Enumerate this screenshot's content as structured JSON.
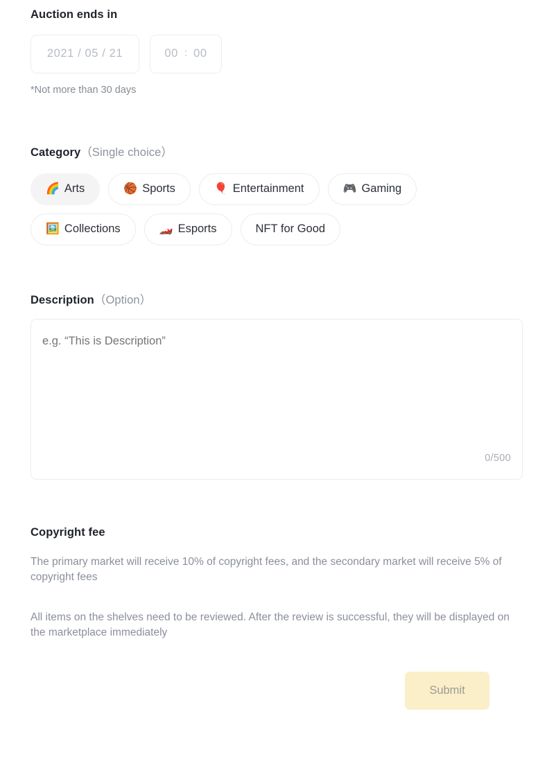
{
  "auction": {
    "title": "Auction ends in",
    "date_placeholder": "2021 / 05 / 21",
    "time_hour_placeholder": "00",
    "time_separator": ":",
    "time_minute_placeholder": "00",
    "hint": "*Not more than 30 days"
  },
  "category": {
    "title": "Category",
    "subtitle": "（Single choice）",
    "selected": "Arts",
    "chips": [
      {
        "label": "Arts",
        "emoji": "🌈",
        "icon_name": "rainbow-icon",
        "selected": true
      },
      {
        "label": "Sports",
        "emoji": "🏀",
        "icon_name": "basketball-icon",
        "selected": false
      },
      {
        "label": "Entertainment",
        "emoji": "🎈",
        "icon_name": "balloon-icon",
        "selected": false
      },
      {
        "label": "Gaming",
        "emoji": "🎮",
        "icon_name": "video-game-controller-icon",
        "selected": false
      },
      {
        "label": "Collections",
        "emoji": "🖼️",
        "icon_name": "framed-picture-icon",
        "selected": false
      },
      {
        "label": "Esports",
        "emoji": "🏎️",
        "icon_name": "racing-car-icon",
        "selected": false
      },
      {
        "label": "NFT for Good",
        "emoji": "",
        "icon_name": "",
        "selected": false
      }
    ]
  },
  "description": {
    "title": "Description",
    "subtitle": "（Option）",
    "placeholder": "e.g. “This is Description”",
    "value": "",
    "counter": "0/500"
  },
  "copyright": {
    "title": "Copyright fee",
    "paragraph_1": "The primary market will receive 10% of copyright fees, and the secondary market will receive 5% of copyright fees",
    "paragraph_2": "All items on the shelves need to be reviewed. After the review is successful, they will be displayed on the marketplace immediately"
  },
  "submit": {
    "label": "Submit"
  },
  "colors": {
    "submit_bg": "#faefc8",
    "submit_text": "#9b9b95",
    "chip_selected_bg": "#f4f4f5",
    "border": "#ededf0",
    "muted_text": "#8a8f99",
    "heading_text": "#1f2329"
  }
}
